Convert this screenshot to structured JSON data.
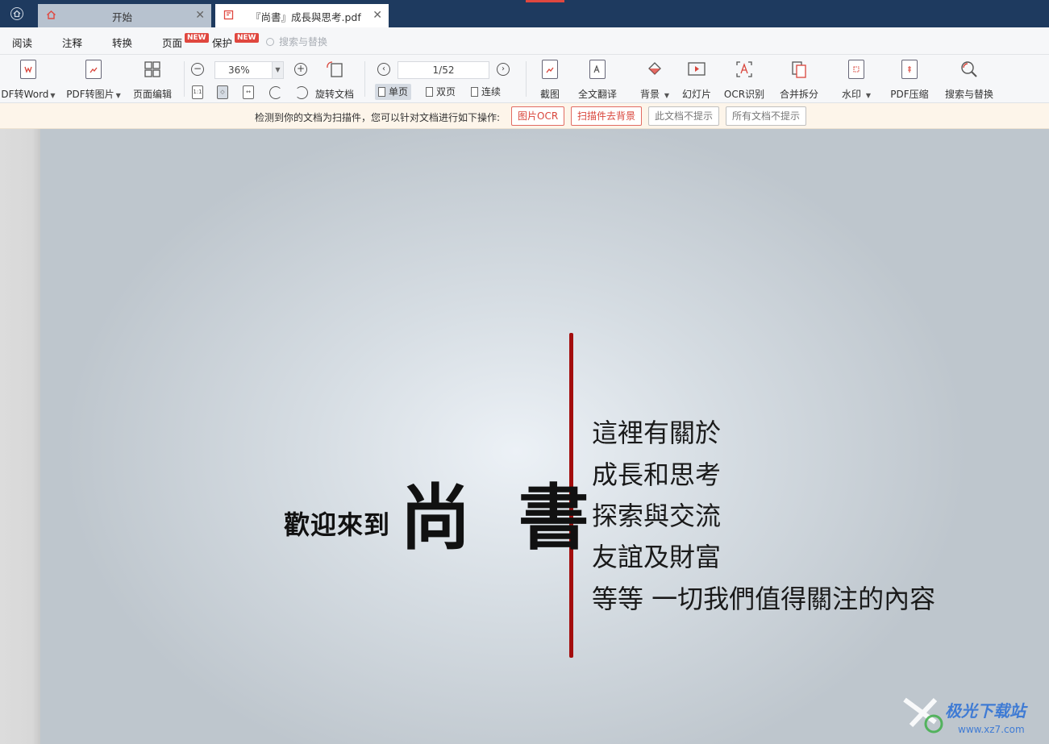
{
  "tabs": [
    {
      "label": "开始"
    },
    {
      "label": "『尚書』成長與思考.pdf"
    }
  ],
  "menu": {
    "items": [
      "阅读",
      "注释",
      "转换",
      "页面",
      "保护"
    ],
    "new_badge": "NEW",
    "search_placeholder": "搜索与替换"
  },
  "toolbar": {
    "pdf_to_word": "DF转Word",
    "pdf_to_image": "PDF转图片",
    "page_edit": "页面编辑",
    "zoom": "36%",
    "rotate_doc": "旋转文档",
    "page_indicator": "1/52",
    "single_page": "单页",
    "double_page": "双页",
    "continuous": "连续",
    "screenshot": "截图",
    "translate": "全文翻译",
    "background": "背景",
    "slideshow": "幻灯片",
    "ocr": "OCR识别",
    "merge_split": "合并拆分",
    "watermark": "水印",
    "compress": "PDF压缩",
    "search_replace": "搜索与替换"
  },
  "notice": {
    "text": "检测到你的文档为扫描件，您可以针对文档进行如下操作:",
    "btn_ocr": "图片OCR",
    "btn_remove_bg": "扫描件去背景",
    "btn_no_prompt_doc": "此文档不提示",
    "btn_no_prompt_all": "所有文档不提示"
  },
  "document": {
    "welcome": "歡迎來到",
    "title": "尚 書",
    "lines": [
      "這裡有關於",
      "成長和思考",
      "探索與交流",
      "友誼及財富",
      "等等 一切我們值得關注的內容"
    ]
  },
  "watermark": {
    "title": "极光下载站",
    "url": "www.xz7.com"
  },
  "colors": {
    "titlebar": "#1e3a5f",
    "accent_red": "#e0473f",
    "divider_red": "#a30d0d"
  }
}
